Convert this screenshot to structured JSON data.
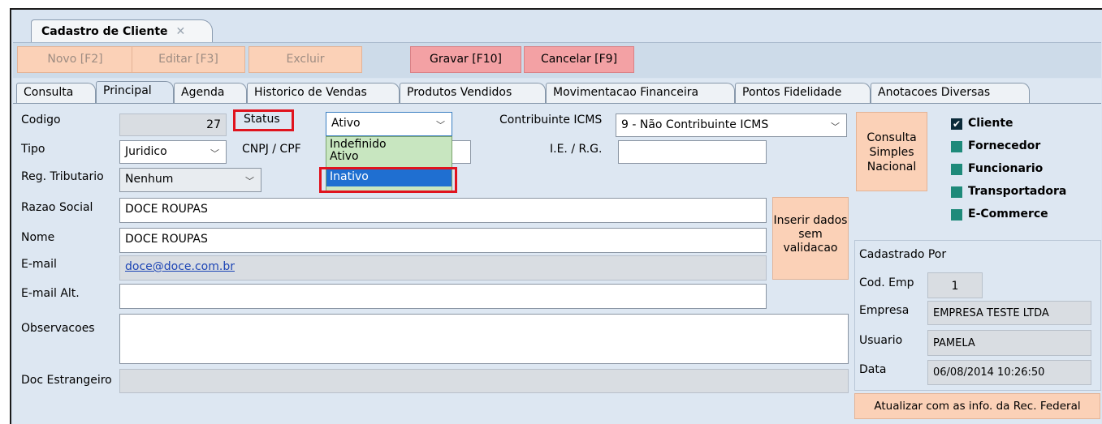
{
  "window": {
    "tab_title": "Cadastro de Cliente",
    "tab_close": "✕"
  },
  "toolbar": {
    "novo": "Novo [F2]",
    "editar": "Editar [F3]",
    "excluir": "Excluir",
    "gravar": "Gravar [F10]",
    "cancelar": "Cancelar [F9]"
  },
  "tabs": [
    "Consulta",
    "Principal",
    "Agenda",
    "Historico de Vendas",
    "Produtos Vendidos",
    "Movimentacao Financeira",
    "Pontos Fidelidade",
    "Anotacoes Diversas"
  ],
  "form": {
    "codigo_label": "Codigo",
    "codigo_value": "27",
    "status_label": "Status",
    "status_value": "Ativo",
    "status_options": [
      "Indefinido",
      "Ativo",
      "Inativo"
    ],
    "contribuinte_label": "Contribuinte ICMS",
    "contribuinte_value": "9 - Não Contribuinte ICMS",
    "tipo_label": "Tipo",
    "tipo_value": "Juridico",
    "cnpj_label": "CNPJ / CPF",
    "cnpj_value": "",
    "ie_label": "I.E. / R.G.",
    "ie_value": "",
    "reg_label": "Reg. Tributario",
    "reg_value": "Nenhum",
    "razao_label": "Razao Social",
    "razao_value": "DOCE ROUPAS",
    "nome_label": "Nome",
    "nome_value": "DOCE ROUPAS",
    "email_label": "E-mail",
    "email_value": "doce@doce.com.br",
    "email_alt_label": "E-mail Alt.",
    "email_alt_value": "",
    "obs_label": "Observacoes",
    "obs_value": "",
    "doc_label": "Doc Estrangeiro",
    "doc_value": ""
  },
  "buttons": {
    "inserir": "Inserir dados sem validacao",
    "consulta_simples": "Consulta Simples Nacional",
    "atualizar": "Atualizar com as info. da Rec. Federal"
  },
  "roles": [
    {
      "label": "Cliente",
      "checked": true
    },
    {
      "label": "Fornecedor",
      "checked": false
    },
    {
      "label": "Funcionario",
      "checked": false
    },
    {
      "label": "Transportadora",
      "checked": false
    },
    {
      "label": "E-Commerce",
      "checked": false
    }
  ],
  "cadastro": {
    "title": "Cadastrado Por",
    "cod_emp_label": "Cod. Emp",
    "cod_emp_value": "1",
    "empresa_label": "Empresa",
    "empresa_value": "EMPRESA TESTE LTDA",
    "usuario_label": "Usuario",
    "usuario_value": "PAMELA",
    "data_label": "Data",
    "data_value": "06/08/2014 10:26:50"
  },
  "colors": {
    "button_orange": "#fbd1b7",
    "button_red": "#f3a1a4",
    "highlight_red": "#e0141e",
    "selection_blue": "#1f6fd1"
  }
}
